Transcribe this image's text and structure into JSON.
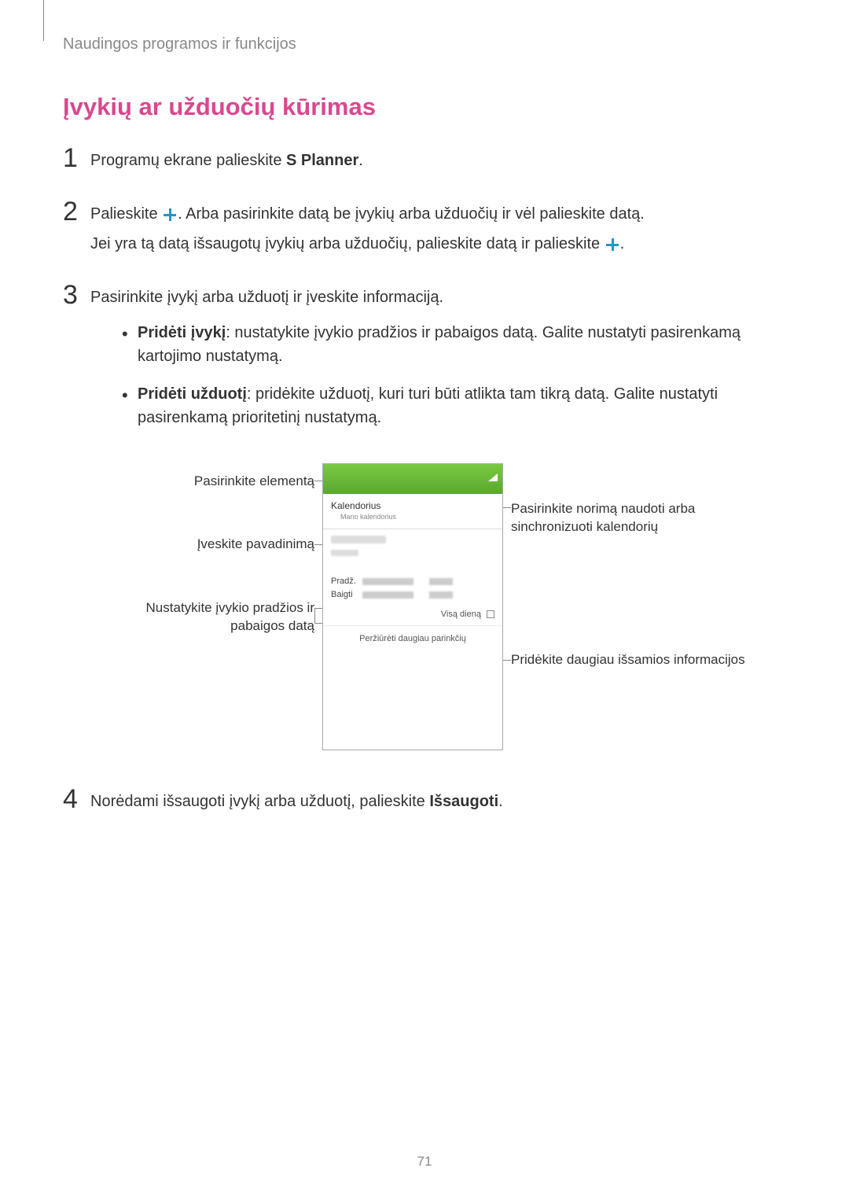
{
  "breadcrumb": "Naudingos programos ir funkcijos",
  "section_title": "Įvykių ar užduočių kūrimas",
  "steps": {
    "1": {
      "num": "1",
      "text_pre": "Programų ekrane palieskite ",
      "text_bold": "S Planner",
      "text_post": "."
    },
    "2": {
      "num": "2",
      "line1_pre": "Palieskite ",
      "line1_post": ". Arba pasirinkite datą be įvykių arba užduočių ir vėl palieskite datą.",
      "line2_pre": "Jei yra tą datą išsaugotų įvykių arba užduočių, palieskite datą ir palieskite ",
      "line2_post": "."
    },
    "3": {
      "num": "3",
      "text": "Pasirinkite įvykį arba užduotį ir įveskite informaciją.",
      "bullets": [
        {
          "bold": "Pridėti įvykį",
          "rest": ": nustatykite įvykio pradžios ir pabaigos datą. Galite nustatyti pasirenkamą kartojimo nustatymą."
        },
        {
          "bold": "Pridėti užduotį",
          "rest": ": pridėkite užduotį, kuri turi būti atlikta tam tikrą datą. Galite nustatyti pasirenkamą prioritetinį nustatymą."
        }
      ]
    },
    "4": {
      "num": "4",
      "text_pre": "Norėdami išsaugoti įvykį arba užduotį, palieskite ",
      "text_bold": "Išsaugoti",
      "text_post": "."
    }
  },
  "diagram": {
    "callouts": {
      "select_item": "Pasirinkite elementą",
      "enter_name": "Įveskite pavadinimą",
      "set_dates": "Nustatykite įvykio pradžios ir pabaigos datą",
      "select_calendar": "Pasirinkite norimą naudoti arba sinchronizuoti kalendorių",
      "add_details": "Pridėkite daugiau išsamios informacijos"
    },
    "phone": {
      "calendar_label": "Kalendorius",
      "my_calendar": "Mano kalendorius",
      "start_label": "Pradž.",
      "end_label": "Baigti",
      "all_day": "Visą dieną",
      "more_options": "Peržiūrėti daugiau parinkčių"
    }
  },
  "page_number": "71"
}
